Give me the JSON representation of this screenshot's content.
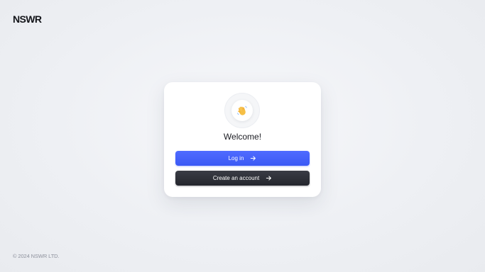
{
  "brand": {
    "logo_text": "NSWR"
  },
  "card": {
    "emoji": "👋",
    "emoji_icon": "waving-hand-icon",
    "title": "Welcome!",
    "login_label": "Log in",
    "create_label": "Create an account",
    "arrow_icon": "arrow-right-icon"
  },
  "footer": {
    "copyright": "© 2024 NSWR LTD."
  },
  "colors": {
    "background": "#eef0f4",
    "card": "#ffffff",
    "login_button": "#3f5df8",
    "create_button": "#2b2d34",
    "footer_text": "#8d919c"
  }
}
